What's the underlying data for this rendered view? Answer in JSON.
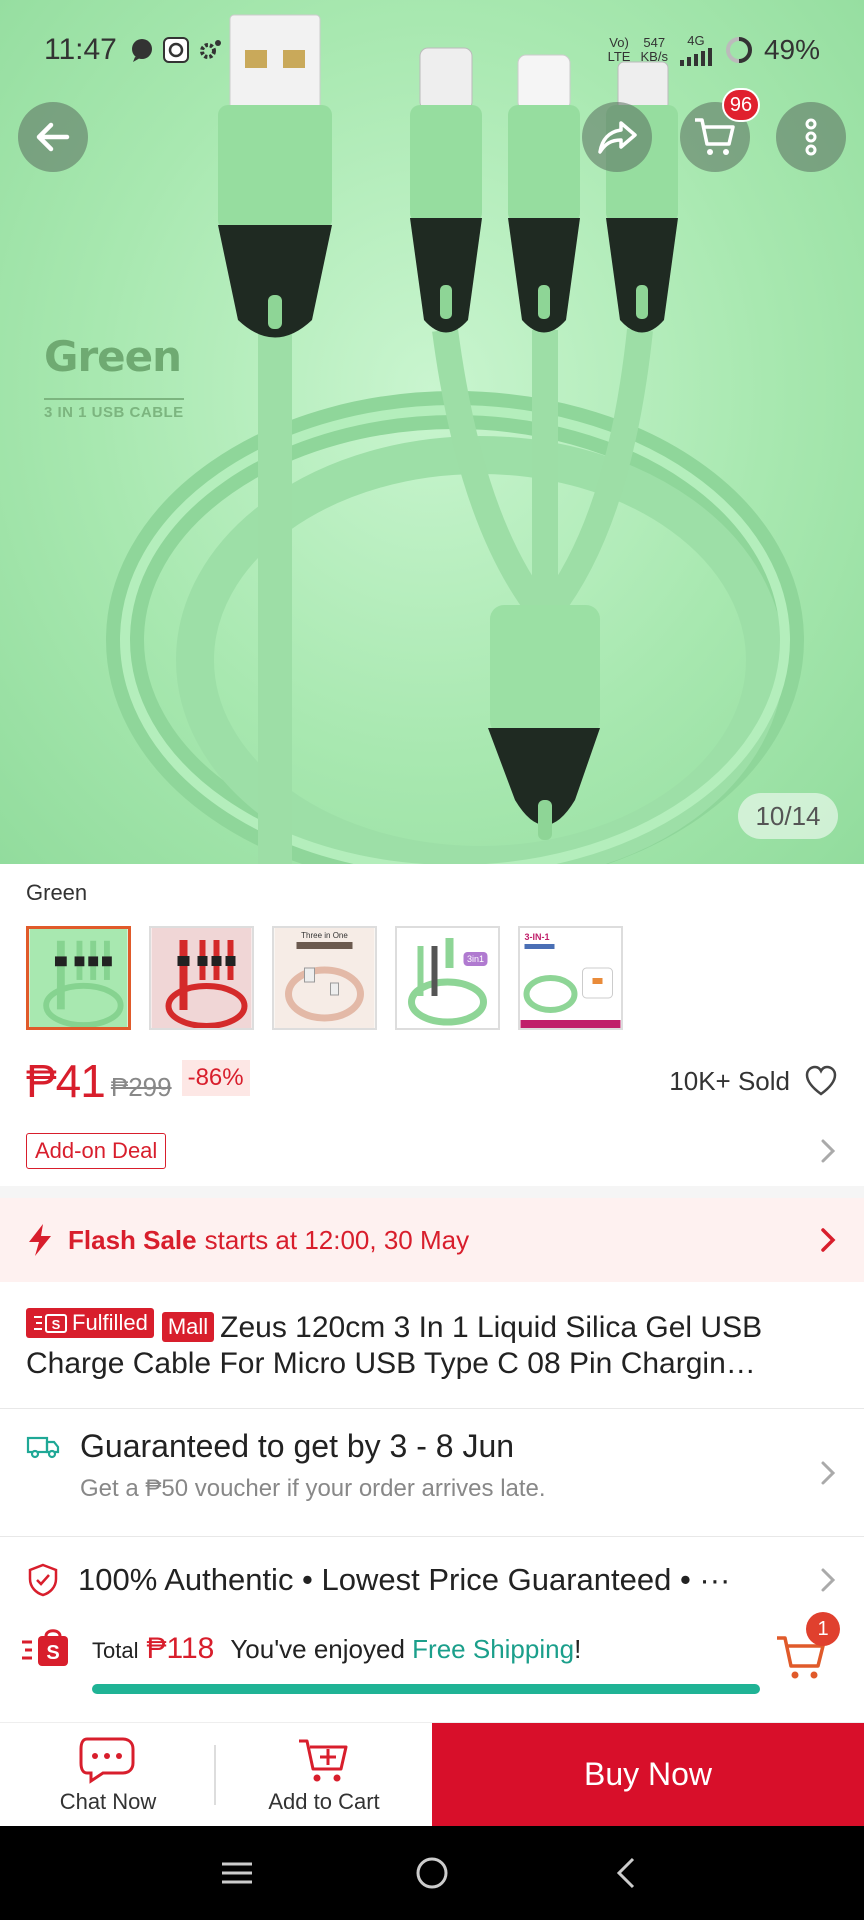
{
  "status_bar": {
    "time": "11:47",
    "network_top": "Vo)",
    "network_bottom": "LTE",
    "speed_value": "547",
    "speed_unit": "KB/s",
    "signal_label": "4G",
    "battery": "49%"
  },
  "hero": {
    "color_label": "Green",
    "color_subtitle": "3 IN 1 USB CABLE",
    "image_counter": "10/14"
  },
  "header": {
    "cart_count": "96"
  },
  "variation": {
    "selected_label": "Green",
    "thumb_texts": [
      "Three in One",
      "3in1",
      "3-IN-1"
    ]
  },
  "price": {
    "current": "₱41",
    "original": "₱299",
    "discount": "-86%",
    "sold": "10K+ Sold"
  },
  "addon": {
    "label": "Add-on Deal"
  },
  "flash_sale": {
    "bold": "Flash Sale",
    "text": "starts at 12:00, 30 May"
  },
  "product": {
    "badge_fulfilled": "Fulfilled",
    "badge_mall": "Mall",
    "title_line1": "Zeus 120cm 3 In 1 Liquid Silica Gel USB",
    "title_line2": "Charge Cable For Micro USB Type C 08 Pin Chargin…"
  },
  "delivery": {
    "main": "Guaranteed to get by 3 - 8 Jun",
    "sub": "Get a ₱50 voucher if your order arrives late."
  },
  "authentic": {
    "text": "100% Authentic  •  Lowest Price Guaranteed  • ···"
  },
  "shipping_bar": {
    "total_label": "Total",
    "total": "₱118",
    "text_before": "You've enjoyed",
    "free_shipping": "Free Shipping",
    "text_after": "!",
    "cart_count": "1",
    "progress": 1.0,
    "accent_color": "#1fb395"
  },
  "bottom_bar": {
    "chat": "Chat Now",
    "add_to_cart": "Add to Cart",
    "buy_now": "Buy Now"
  },
  "colors": {
    "brand_red": "#d81e2c",
    "teal": "#1b9f8b"
  }
}
